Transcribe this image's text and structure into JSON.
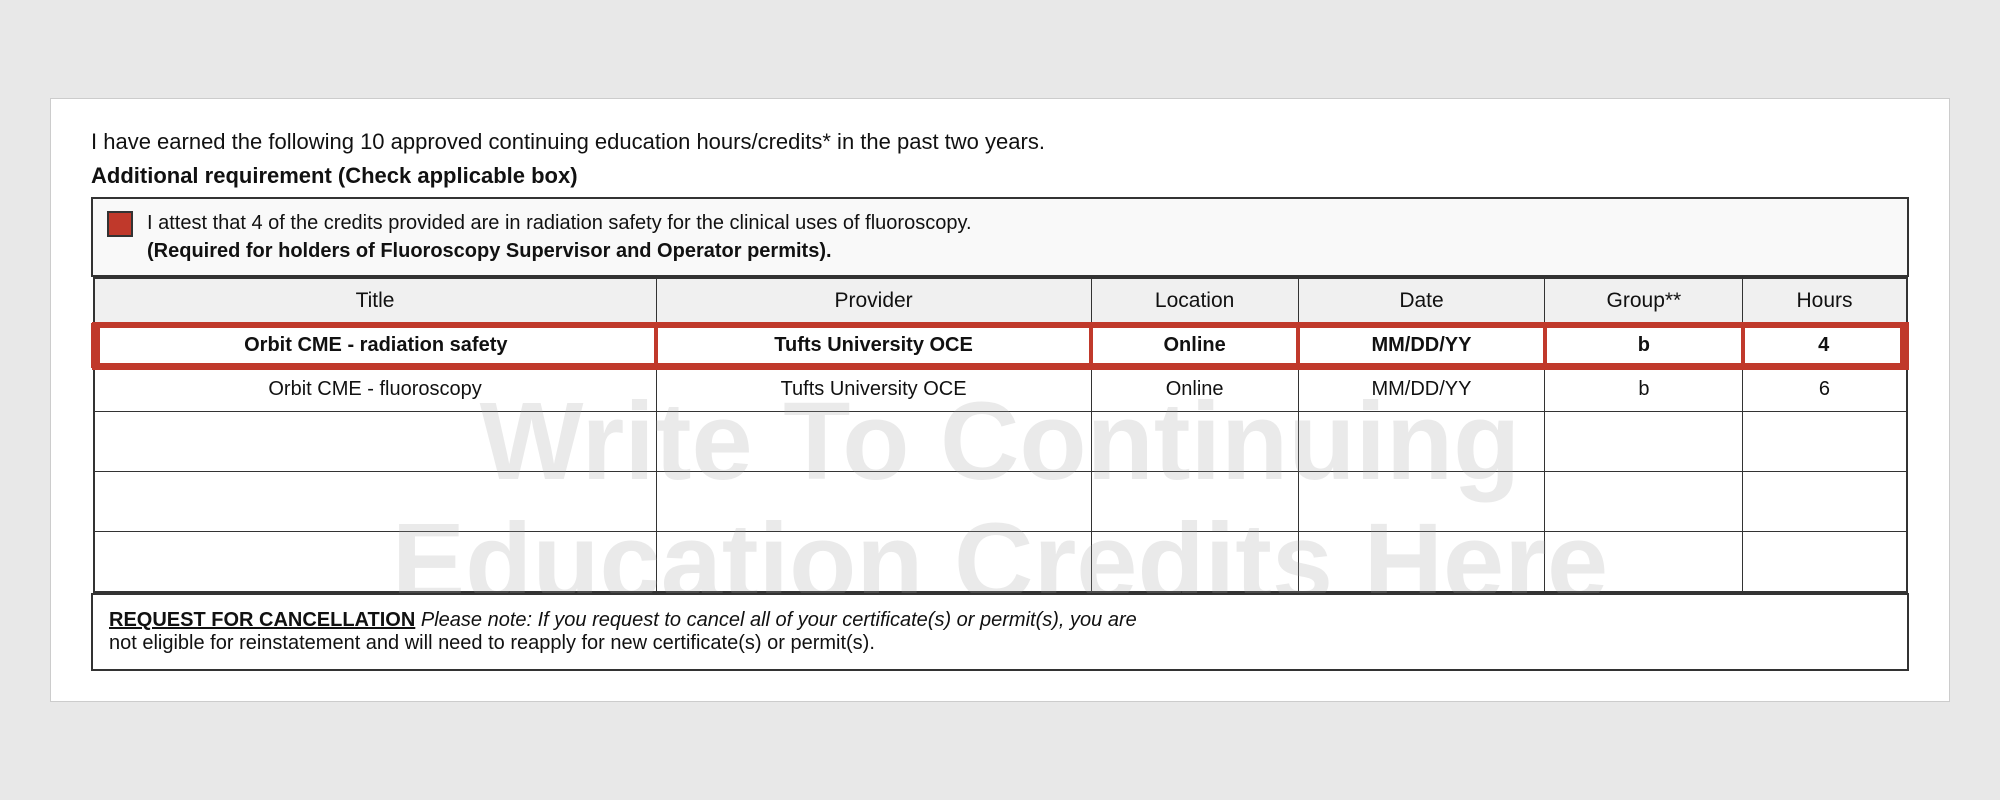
{
  "intro": {
    "line1": "I have earned the following 10 approved continuing education hours/credits* in the past two years.",
    "line2_bold": "Additional requirement (Check applicable box)"
  },
  "checkbox": {
    "text_normal": "I attest that 4 of the credits provided are in radiation safety for the clinical uses of fluoroscopy.",
    "text_bold": "(Required for holders of Fluoroscopy Supervisor and Operator permits)."
  },
  "table": {
    "headers": [
      "Title",
      "Provider",
      "Location",
      "Date",
      "Group**",
      "Hours"
    ],
    "rows": [
      {
        "title": "Orbit CME - radiation safety",
        "provider": "Tufts University OCE",
        "location": "Online",
        "date": "MM/DD/YY",
        "group": "b",
        "hours": "4",
        "highlighted": true
      },
      {
        "title": "Orbit CME - fluoroscopy",
        "provider": "Tufts University OCE",
        "location": "Online",
        "date": "MM/DD/YY",
        "group": "b",
        "hours": "6",
        "highlighted": false
      },
      {
        "title": "",
        "provider": "",
        "location": "",
        "date": "",
        "group": "",
        "hours": "",
        "highlighted": false
      },
      {
        "title": "",
        "provider": "",
        "location": "",
        "date": "",
        "group": "",
        "hours": "",
        "highlighted": false
      },
      {
        "title": "",
        "provider": "",
        "location": "",
        "date": "",
        "group": "",
        "hours": "",
        "highlighted": false
      }
    ],
    "watermark_line1": "Write To Continuing",
    "watermark_line2": "Education Credits Here"
  },
  "footer": {
    "label": "REQUEST FOR CANCELLATION",
    "text": " Please note: If you request to cancel all of your certificate(s) or permit(s), you are",
    "line2": "not eligible for reinstatement and will need to reapply for new certificate(s) or permit(s)."
  }
}
